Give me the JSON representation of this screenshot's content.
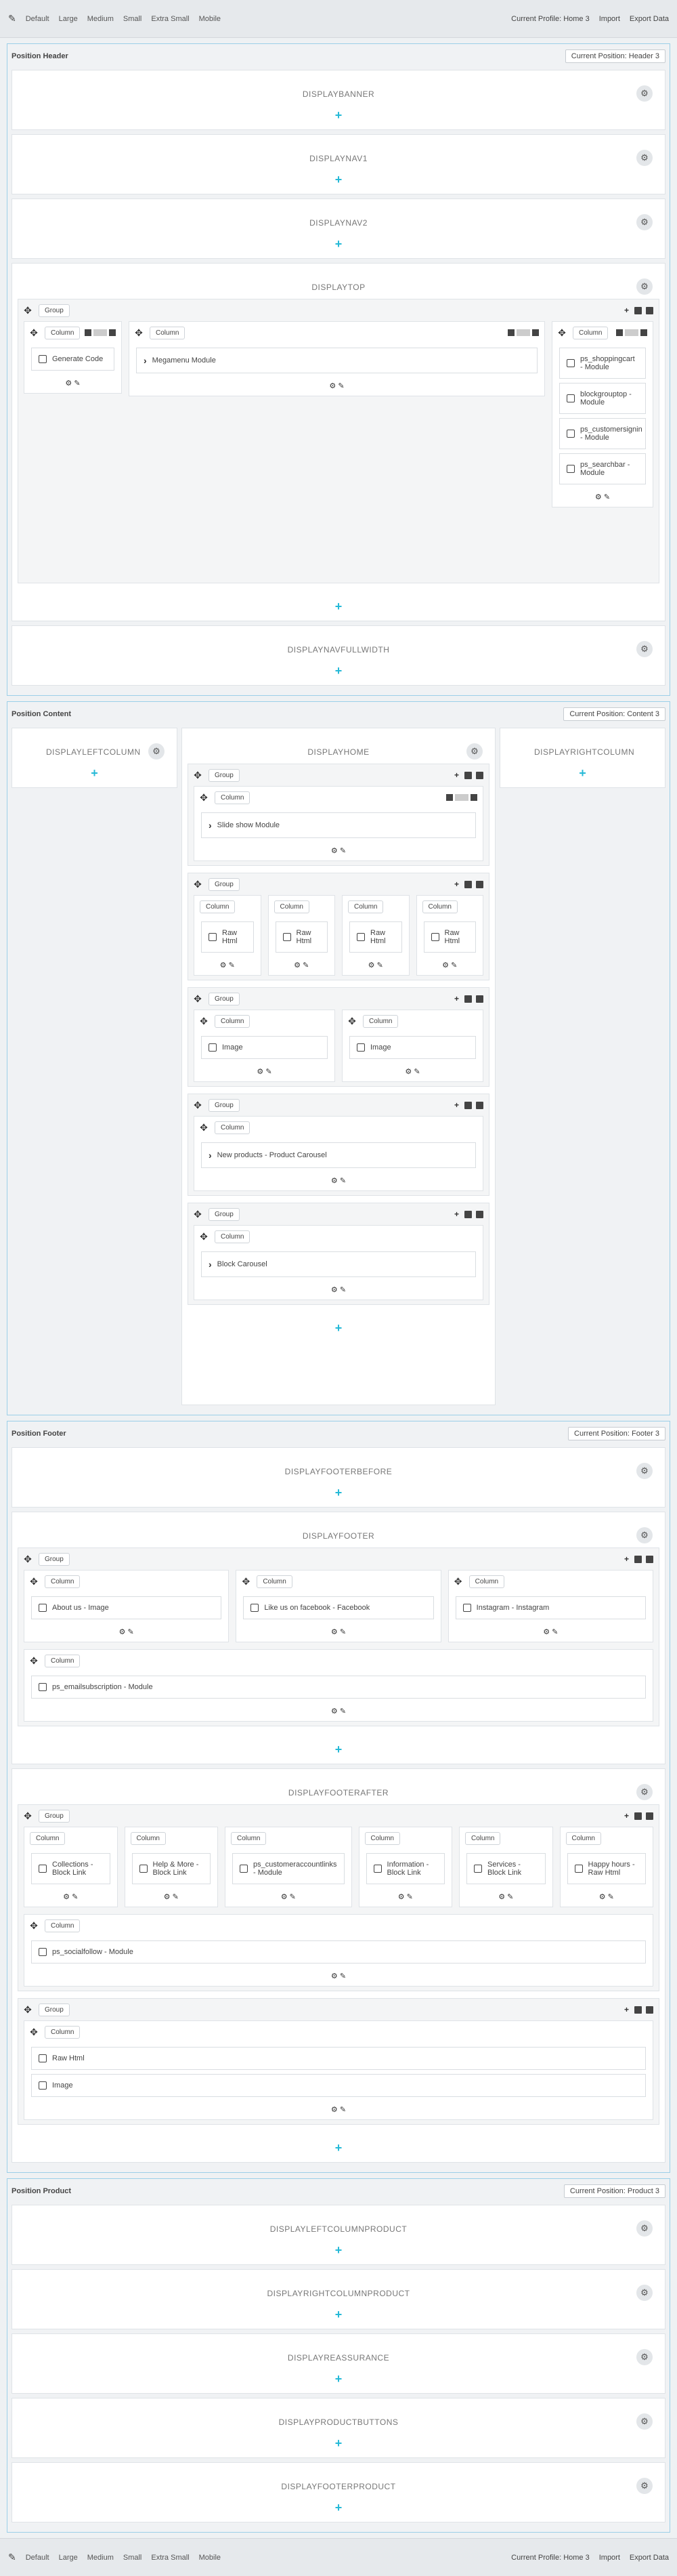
{
  "toolbar": {
    "devices": [
      "Default",
      "Large",
      "Medium",
      "Small",
      "Extra Small",
      "Mobile"
    ],
    "profile": "Current Profile: Home 3",
    "import": "Import",
    "export": "Export Data"
  },
  "header": {
    "title": "Position Header",
    "selector": "Current Position: Header 3",
    "hooks": [
      "DISPLAYBANNER",
      "DISPLAYNAV1",
      "DISPLAYNAV2",
      "DISPLAYTOP",
      "DISPLAYNAVFULLWIDTH"
    ],
    "top_modules": {
      "col1": "Generate Code",
      "col2": "Megamenu Module",
      "col3": [
        "ps_shoppingcart - Module",
        "blockgrouptop - Module",
        "ps_customersignin - Module",
        "ps_searchbar - Module"
      ]
    }
  },
  "content": {
    "title": "Position Content",
    "selector": "Current Position: Content 3",
    "left": "DISPLAYLEFTCOLUMN",
    "home": "DISPLAYHOME",
    "right": "DISPLAYRIGHTCOLUMN",
    "modules": {
      "slideshow": "Slide show Module",
      "raw": "Raw Html",
      "image": "Image",
      "newprod": "New products - Product Carousel",
      "carousel": "Block Carousel"
    }
  },
  "footer": {
    "title": "Position Footer",
    "selector": "Current Position: Footer 3",
    "hooks": [
      "DISPLAYFOOTERBEFORE",
      "DISPLAYFOOTER",
      "DISPLAYFOOTERAFTER"
    ],
    "f1": [
      "About us - Image",
      "Like us on facebook - Facebook",
      "Instagram - Instagram"
    ],
    "f2": "ps_emailsubscription - Module",
    "a1": [
      "Collections - Block Link",
      "Help & More - Block Link",
      "ps_customeraccountlinks - Module",
      "Information - Block Link",
      "Services - Block Link",
      "Happy hours - Raw Html"
    ],
    "a2": "ps_socialfollow - Module",
    "a3": [
      "Raw Html",
      "Image"
    ]
  },
  "product": {
    "title": "Position Product",
    "selector": "Current Position: Product 3",
    "hooks": [
      "DISPLAYLEFTCOLUMNPRODUCT",
      "DISPLAYRIGHTCOLUMNPRODUCT",
      "DISPLAYREASSURANCE",
      "DISPLAYPRODUCTBUTTONS",
      "DISPLAYFOOTERPRODUCT"
    ]
  },
  "labels": {
    "group": "Group",
    "column": "Column",
    "plus": "+"
  }
}
